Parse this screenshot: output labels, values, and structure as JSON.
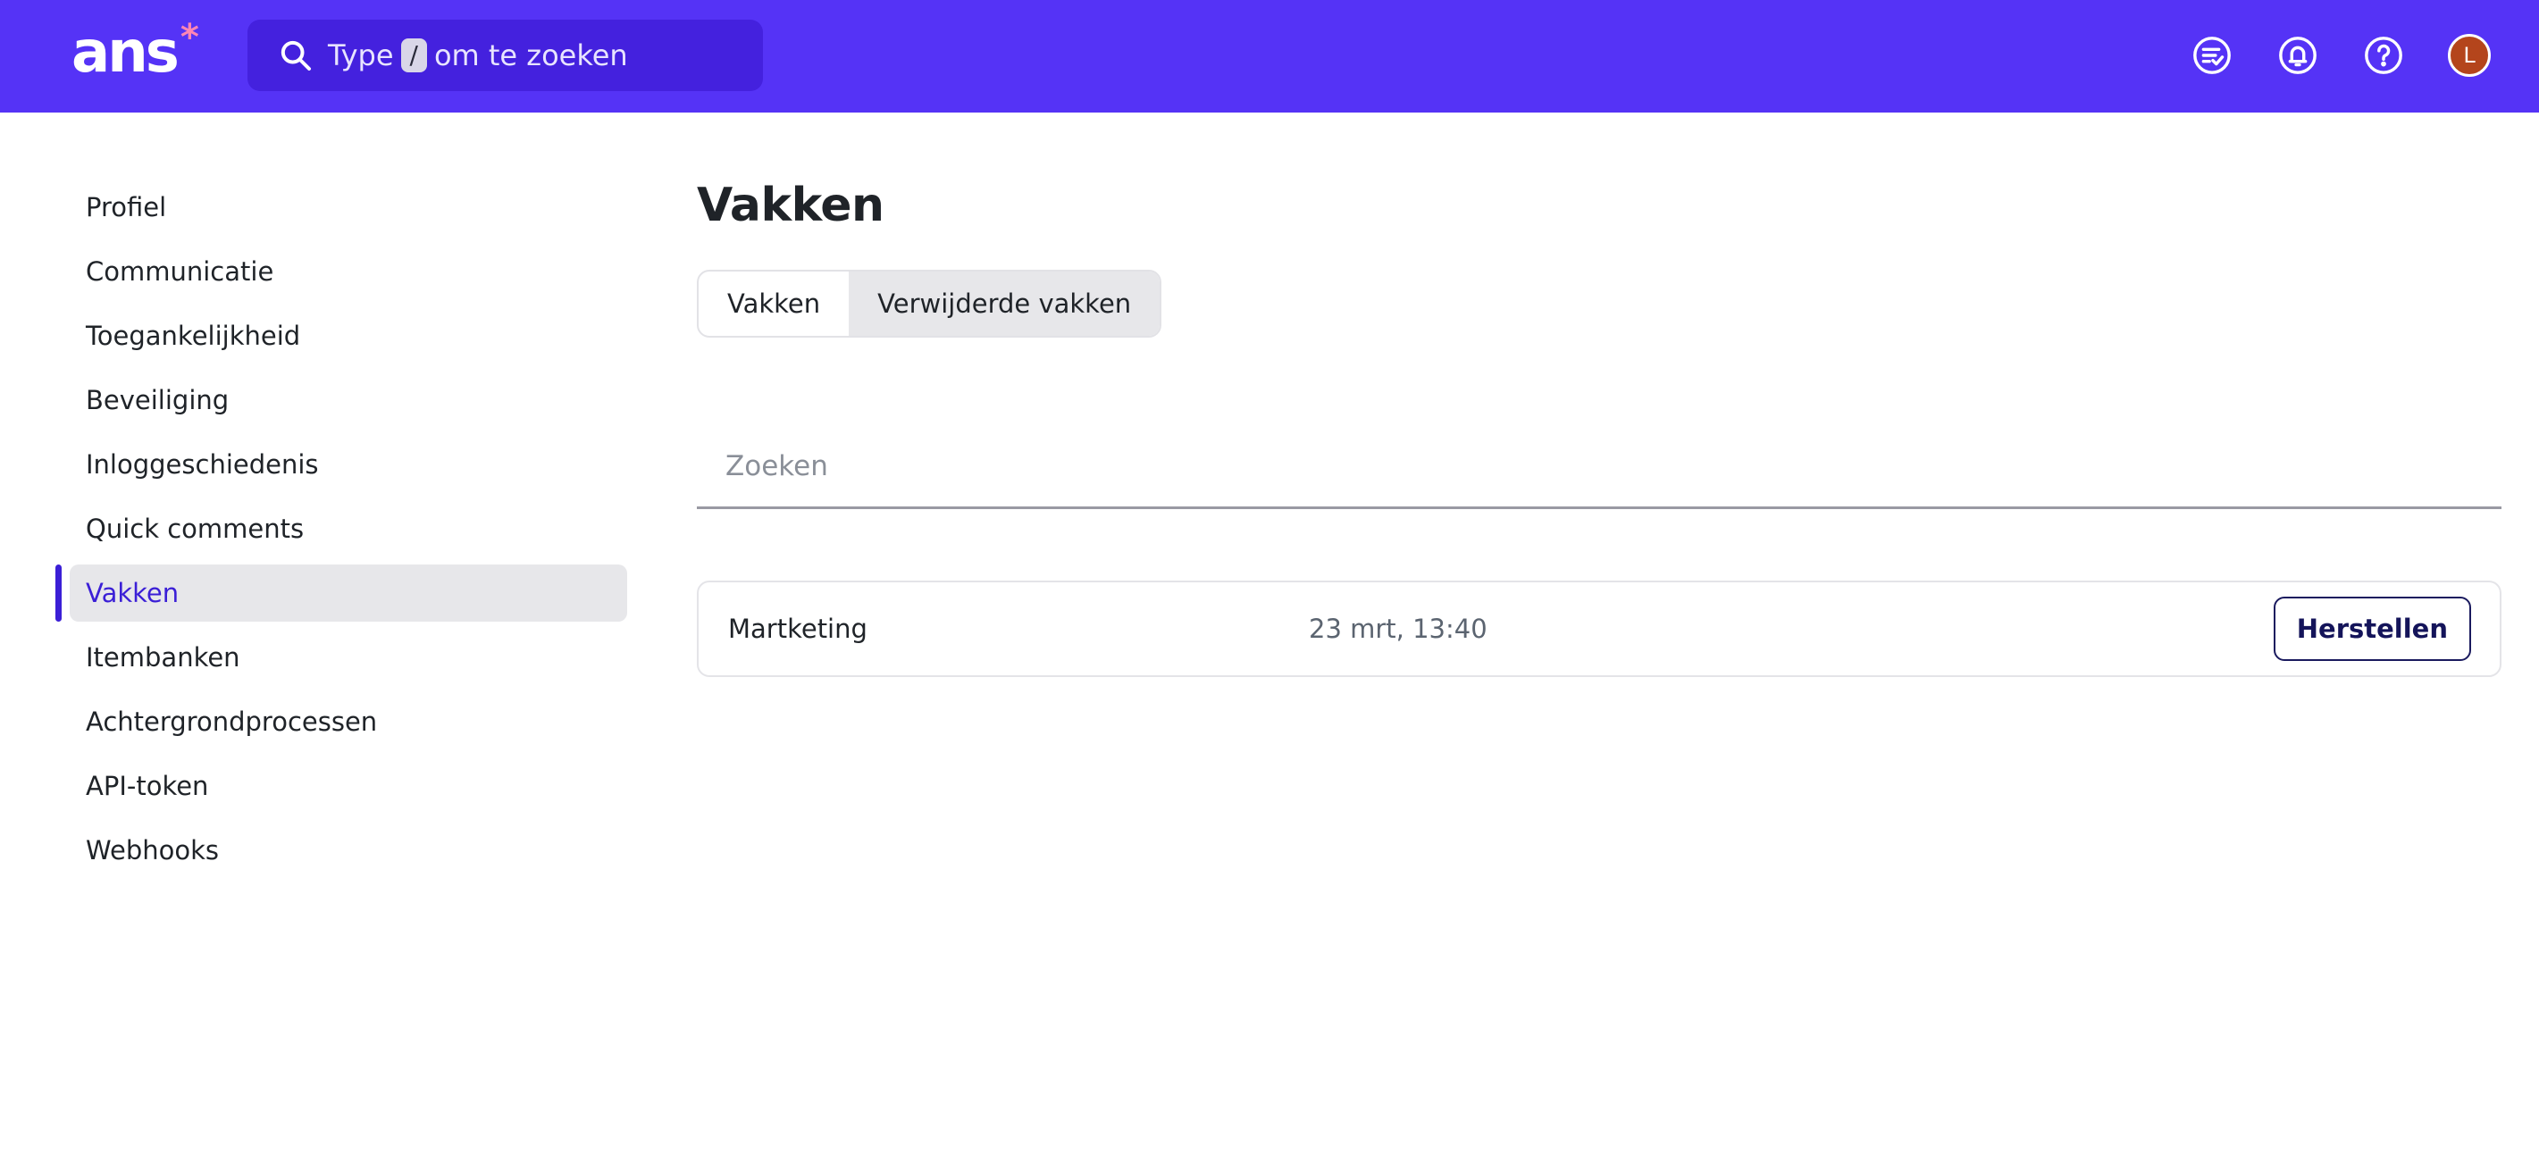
{
  "header": {
    "logo_text": "ans",
    "logo_mark": "*",
    "search": {
      "prefix": "Type",
      "shortcut_key": "/",
      "suffix": "om te zoeken"
    },
    "icons": [
      "task-list-icon",
      "bell-icon",
      "help-icon"
    ],
    "avatar_initial": "L",
    "colors": {
      "bar": "#5533f6",
      "search_bg": "#4421de",
      "logo_star": "#ff86b4",
      "avatar": "#b4451c"
    }
  },
  "sidebar": {
    "items": [
      {
        "label": "Profiel"
      },
      {
        "label": "Communicatie"
      },
      {
        "label": "Toegankelijkheid"
      },
      {
        "label": "Beveiliging"
      },
      {
        "label": "Inloggeschiedenis"
      },
      {
        "label": "Quick comments"
      },
      {
        "label": "Vakken",
        "active": true
      },
      {
        "label": "Itembanken"
      },
      {
        "label": "Achtergrondprocessen"
      },
      {
        "label": "API-token"
      },
      {
        "label": "Webhooks"
      }
    ],
    "active_color": "#3b1fd6"
  },
  "main": {
    "title": "Vakken",
    "tabs": [
      {
        "label": "Vakken",
        "selected": false
      },
      {
        "label": "Verwijderde vakken",
        "selected": true
      }
    ],
    "search": {
      "placeholder": "Zoeken",
      "value": ""
    },
    "rows": [
      {
        "name": "Martketing",
        "date": "23 mrt, 13:40",
        "action": "Herstellen"
      }
    ]
  }
}
